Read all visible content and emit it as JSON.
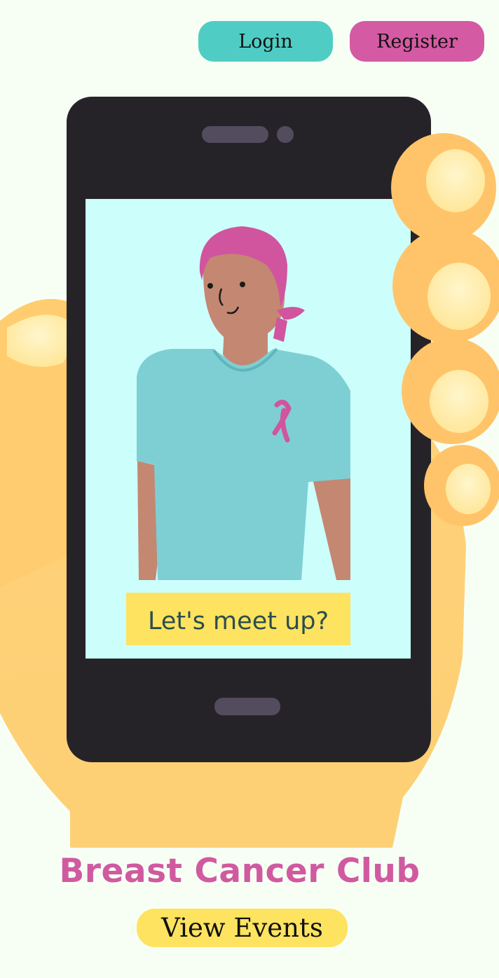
{
  "header": {
    "login_label": "Login",
    "register_label": "Register",
    "login_color": "#4fcdc4",
    "register_color": "#d45aa3"
  },
  "hero": {
    "phone_caption": "Let's meet up?",
    "caption_color": "#fde35f"
  },
  "main": {
    "title": "Breast Cancer Club",
    "title_color": "#d05aa0",
    "view_events_label": "View Events",
    "view_events_color": "#fde35f"
  }
}
